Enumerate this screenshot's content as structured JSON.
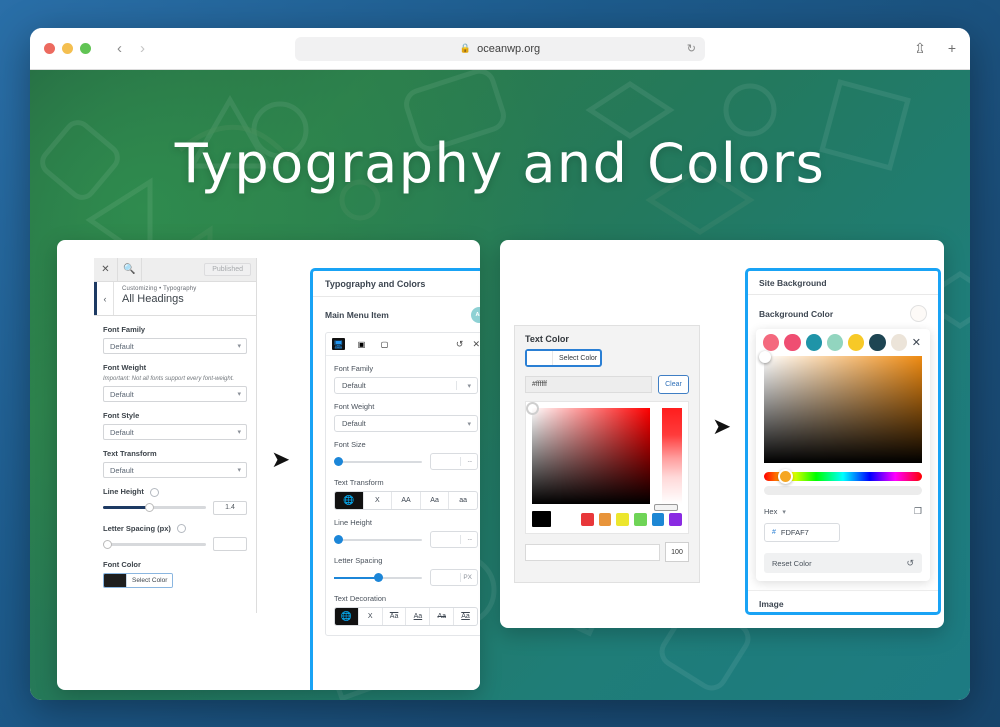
{
  "browser": {
    "url": "oceanwp.org",
    "lock_icon": "lock-icon",
    "back_icon": "‹",
    "forward_icon": "›",
    "reload_icon": "↻",
    "share_icon": "⤴",
    "new_tab_icon": "+"
  },
  "page": {
    "title": "Typography and Colors"
  },
  "arrows": {
    "arrow1": "➤",
    "arrow2": "➤"
  },
  "panel1": {
    "close_icon": "✕",
    "search_icon": "⌕",
    "published_label": "Published",
    "back_icon": "‹",
    "breadcrumb": "Customizing • Typography",
    "section_title": "All Headings",
    "fields": [
      {
        "label": "Font Family",
        "value": "Default",
        "note": ""
      },
      {
        "label": "Font Weight",
        "value": "Default",
        "note": "Important: Not all fonts support every font-weight."
      },
      {
        "label": "Font Style",
        "value": "Default",
        "note": ""
      },
      {
        "label": "Text Transform",
        "value": "Default",
        "note": ""
      }
    ],
    "line_height": {
      "label": "Line Height",
      "value": "1.4"
    },
    "letter_spacing": {
      "label": "Letter Spacing (px)",
      "value": ""
    },
    "font_color": {
      "label": "Font Color",
      "button_label": "Select Color",
      "swatch_hex": "#1e1e1e"
    }
  },
  "panel2": {
    "header": "Typography and Colors",
    "group_label": "Main Menu Item",
    "badge": "Aa",
    "devices": [
      "desktop-icon",
      "tablet-icon",
      "mobile-icon"
    ],
    "reset_icon": "↺",
    "close_icon": "✕",
    "font_family": {
      "label": "Font Family",
      "value": "Default"
    },
    "font_weight": {
      "label": "Font Weight",
      "value": "Default"
    },
    "font_size": {
      "label": "Font Size",
      "unit": "--"
    },
    "text_transform": {
      "label": "Text Transform",
      "options": [
        "globe-icon",
        "X",
        "AA",
        "Aa",
        "aa"
      ],
      "active": 0
    },
    "line_height": {
      "label": "Line Height",
      "unit": "--"
    },
    "letter_spacing": {
      "label": "Letter Spacing",
      "unit": "PX"
    },
    "text_decoration": {
      "label": "Text Decoration",
      "options": [
        "globe-icon",
        "X",
        "Aa",
        "Aa",
        "Aa",
        "Aa"
      ],
      "active": 0
    }
  },
  "panel3": {
    "title": "Text Color",
    "select_color_label": "Select Color",
    "hex_value": "#ffffff",
    "clear_label": "Clear",
    "alpha_value": "100",
    "swatches": [
      "#000000",
      "#ffffff",
      "#e8373a",
      "#e8943a",
      "#ece62e",
      "#6fd457",
      "#1d87d4",
      "#8a2be2"
    ]
  },
  "panel4": {
    "header": "Site Background",
    "bg_color_label": "Background Color",
    "bg_swatch_hex": "#FDFAF7",
    "close_icon": "✕",
    "palette": [
      "#f4697e",
      "#ef4e72",
      "#1f94a8",
      "#92d5bf",
      "#f7c927",
      "#1e4553",
      "#ece4d9"
    ],
    "hex_label": "Hex",
    "hex_caret": "⌄",
    "copy_icon": "copy-icon",
    "hex_value": "FDFAF7",
    "hash": "#",
    "reset_label": "Reset Color",
    "reset_icon": "↺",
    "image_label": "Image"
  }
}
